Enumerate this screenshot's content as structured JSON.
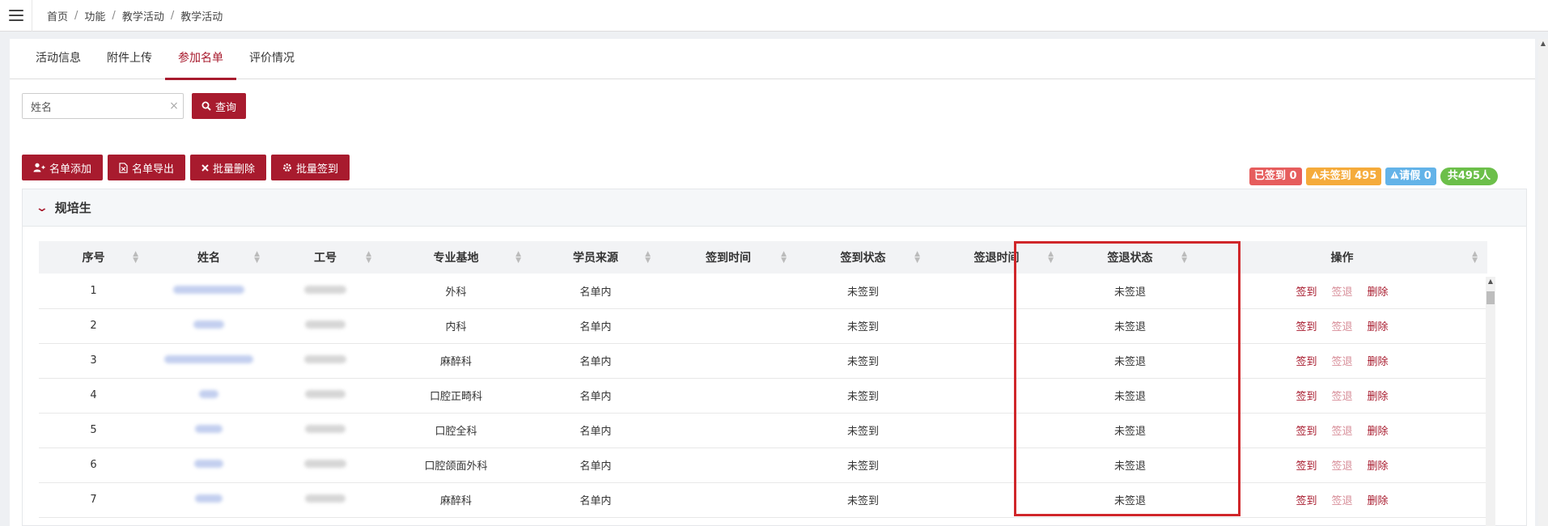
{
  "breadcrumb": [
    "首页",
    "功能",
    "教学活动",
    "教学活动"
  ],
  "tabs": [
    {
      "label": "活动信息",
      "active": false
    },
    {
      "label": "附件上传",
      "active": false
    },
    {
      "label": "参加名单",
      "active": true
    },
    {
      "label": "评价情况",
      "active": false
    }
  ],
  "search": {
    "value": "姓名",
    "clear_icon": "×",
    "query_label": "查询"
  },
  "actions": {
    "add": "名单添加",
    "export": "名单导出",
    "batch_delete": "批量删除",
    "batch_signin": "批量签到"
  },
  "badges": {
    "signed": "已签到 0",
    "unsigned": "未签到 495",
    "leave": "请假 0",
    "total": "共495人"
  },
  "group": {
    "title": "规培生"
  },
  "table": {
    "headers": [
      "序号",
      "姓名",
      "工号",
      "专业基地",
      "学员来源",
      "签到时间",
      "签到状态",
      "签退时间",
      "签退状态",
      "操作"
    ],
    "rows": [
      {
        "index": "1",
        "dept": "外科",
        "source": "名单内",
        "signin_time": "",
        "signin_status": "未签到",
        "signout_time": "",
        "signout_status": "未签退"
      },
      {
        "index": "2",
        "dept": "内科",
        "source": "名单内",
        "signin_time": "",
        "signin_status": "未签到",
        "signout_time": "",
        "signout_status": "未签退"
      },
      {
        "index": "3",
        "dept": "麻醉科",
        "source": "名单内",
        "signin_time": "",
        "signin_status": "未签到",
        "signout_time": "",
        "signout_status": "未签退"
      },
      {
        "index": "4",
        "dept": "口腔正畸科",
        "source": "名单内",
        "signin_time": "",
        "signin_status": "未签到",
        "signout_time": "",
        "signout_status": "未签退"
      },
      {
        "index": "5",
        "dept": "口腔全科",
        "source": "名单内",
        "signin_time": "",
        "signin_status": "未签到",
        "signout_time": "",
        "signout_status": "未签退"
      },
      {
        "index": "6",
        "dept": "口腔颌面外科",
        "source": "名单内",
        "signin_time": "",
        "signin_status": "未签到",
        "signout_time": "",
        "signout_status": "未签退"
      },
      {
        "index": "7",
        "dept": "麻醉科",
        "source": "名单内",
        "signin_time": "",
        "signin_status": "未签到",
        "signout_time": "",
        "signout_status": "未签退"
      }
    ],
    "ops": {
      "signin": "签到",
      "signout": "签退",
      "delete": "删除"
    }
  },
  "colors": {
    "accent": "#a81b2e",
    "highlight": "#d0262a"
  }
}
